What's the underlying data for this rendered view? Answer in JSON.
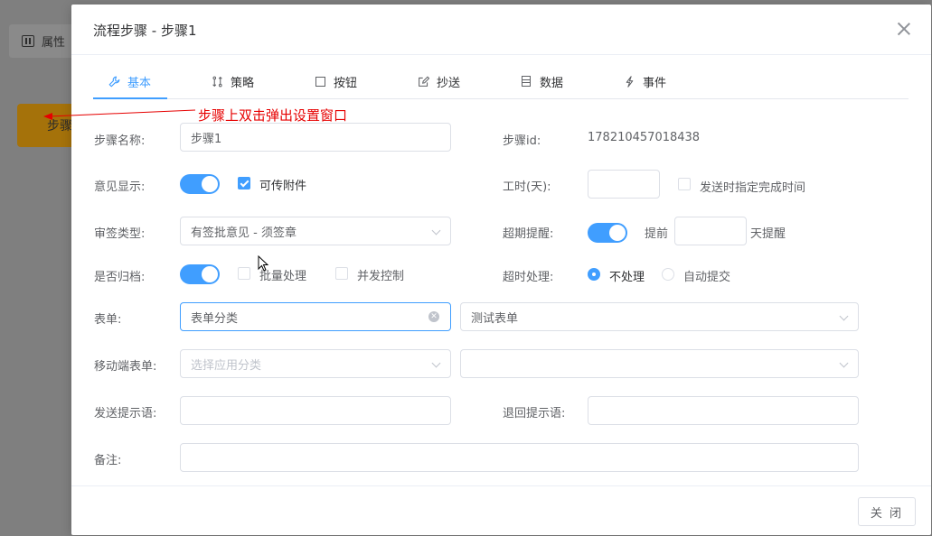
{
  "background": {
    "properties_button": "属性",
    "step_node": "步骤"
  },
  "dialog": {
    "title": "流程步骤 - 步骤1",
    "tabs": [
      {
        "label": "基本",
        "icon": "wrench-icon",
        "active": true
      },
      {
        "label": "策略",
        "icon": "strategy-icon",
        "active": false
      },
      {
        "label": "按钮",
        "icon": "square-icon",
        "active": false
      },
      {
        "label": "抄送",
        "icon": "edit-icon",
        "active": false
      },
      {
        "label": "数据",
        "icon": "database-icon",
        "active": false
      },
      {
        "label": "事件",
        "icon": "lightning-icon",
        "active": false
      }
    ],
    "form": {
      "step_name_label": "步骤名称:",
      "step_name_value": "步骤1",
      "step_id_label": "步骤id:",
      "step_id_value": "178210457018438",
      "opinion_display_label": "意见显示:",
      "opinion_display_on": true,
      "attach_label": "可传附件",
      "attach_checked": true,
      "work_time_label": "工时(天):",
      "work_time_value": "",
      "specify_time_label": "发送时指定完成时间",
      "specify_time_checked": false,
      "sign_type_label": "审签类型:",
      "sign_type_value": "有签批意见 - 须签章",
      "overdue_label": "超期提醒:",
      "overdue_on": true,
      "advance_prefix": "提前",
      "advance_value": "",
      "advance_suffix": "天提醒",
      "archive_label": "是否归档:",
      "archive_on": true,
      "batch_label": "批量处理",
      "batch_checked": false,
      "concurrent_label": "并发控制",
      "concurrent_checked": false,
      "timeout_label": "超时处理:",
      "timeout_options": [
        "不处理",
        "自动提交"
      ],
      "timeout_selected": "不处理",
      "form_label": "表单:",
      "form_category_value": "表单分类",
      "form_value": "测试表单",
      "mobile_form_label": "移动端表单:",
      "mobile_category_placeholder": "选择应用分类",
      "mobile_form_value": "",
      "send_hint_label": "发送提示语:",
      "send_hint_value": "",
      "return_hint_label": "退回提示语:",
      "return_hint_value": "",
      "remark_label": "备注:",
      "remark_value": ""
    },
    "close_button": "关 闭"
  },
  "annotation": {
    "text": "步骤上双击弹出设置窗口",
    "color": "#e60000"
  },
  "colors": {
    "primary": "#409eff",
    "node": "#a5720a"
  }
}
